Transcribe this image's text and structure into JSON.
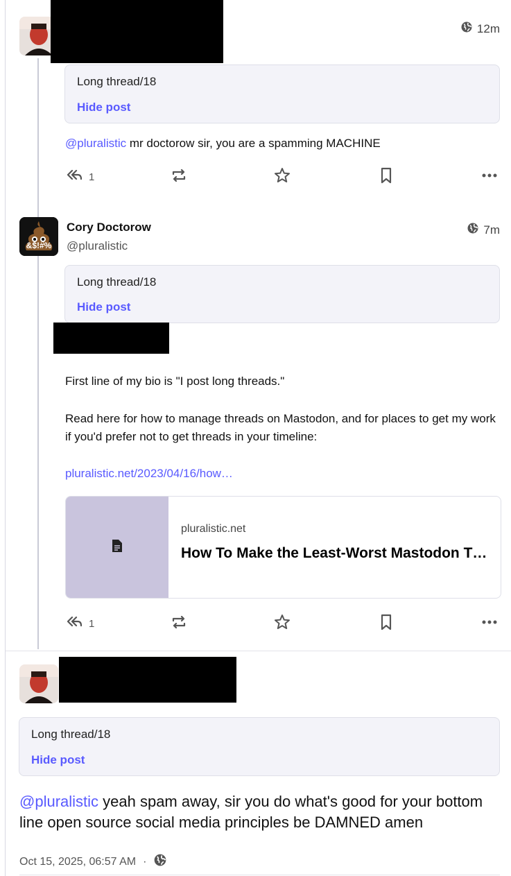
{
  "posts": [
    {
      "time": "12m",
      "visibility_icon": "globe-icon",
      "cw": {
        "title": "Long thread/18",
        "hide": "Hide post"
      },
      "mention": "@pluralistic",
      "text": " mr doctorow sir, you are a spamming MACHINE",
      "actions": {
        "reply_count": "1"
      }
    },
    {
      "author": {
        "name": "Cory Doctorow",
        "handle": "@pluralistic",
        "avatar_label": "&$!#%"
      },
      "time": "7m",
      "visibility_icon": "globe-icon",
      "cw": {
        "title": "Long thread/18",
        "hide": "Hide post"
      },
      "paragraphs": [
        "First line of my bio is \"I post long threads.\"",
        "Read here for how to manage threads on Mastodon, and for places to get my work if you'd prefer not to get threads in your timeline:"
      ],
      "link": "pluralistic.net/2023/04/16/how…",
      "card": {
        "domain": "pluralistic.net",
        "title": "How To Make the Least-Worst Mastodon Threads"
      },
      "actions": {
        "reply_count": "1"
      }
    }
  ],
  "detail": {
    "cw": {
      "title": "Long thread/18",
      "hide": "Hide post"
    },
    "mention": "@pluralistic",
    "text": " yeah spam away, sir you do what's good for your bottom line open source social media principles be DAMNED amen",
    "timestamp": "Oct 15, 2025, 06:57 AM",
    "separator": "·",
    "visibility_icon": "globe-icon"
  },
  "colors": {
    "accent": "#595aff",
    "card_thumb": "#c9c4dd"
  }
}
